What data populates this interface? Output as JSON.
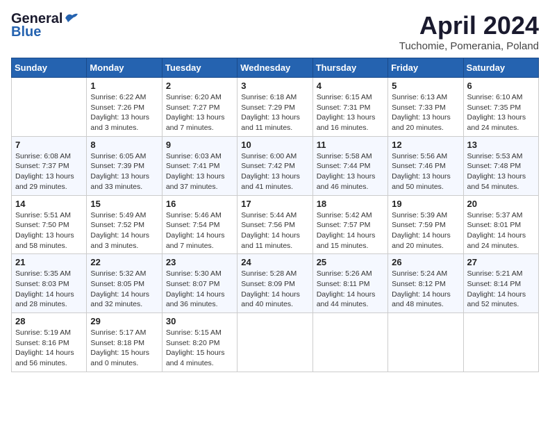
{
  "header": {
    "logo_general": "General",
    "logo_blue": "Blue",
    "month_title": "April 2024",
    "location": "Tuchomie, Pomerania, Poland"
  },
  "calendar": {
    "days_of_week": [
      "Sunday",
      "Monday",
      "Tuesday",
      "Wednesday",
      "Thursday",
      "Friday",
      "Saturday"
    ],
    "weeks": [
      [
        {
          "day": "",
          "info": ""
        },
        {
          "day": "1",
          "info": "Sunrise: 6:22 AM\nSunset: 7:26 PM\nDaylight: 13 hours\nand 3 minutes."
        },
        {
          "day": "2",
          "info": "Sunrise: 6:20 AM\nSunset: 7:27 PM\nDaylight: 13 hours\nand 7 minutes."
        },
        {
          "day": "3",
          "info": "Sunrise: 6:18 AM\nSunset: 7:29 PM\nDaylight: 13 hours\nand 11 minutes."
        },
        {
          "day": "4",
          "info": "Sunrise: 6:15 AM\nSunset: 7:31 PM\nDaylight: 13 hours\nand 16 minutes."
        },
        {
          "day": "5",
          "info": "Sunrise: 6:13 AM\nSunset: 7:33 PM\nDaylight: 13 hours\nand 20 minutes."
        },
        {
          "day": "6",
          "info": "Sunrise: 6:10 AM\nSunset: 7:35 PM\nDaylight: 13 hours\nand 24 minutes."
        }
      ],
      [
        {
          "day": "7",
          "info": "Sunrise: 6:08 AM\nSunset: 7:37 PM\nDaylight: 13 hours\nand 29 minutes."
        },
        {
          "day": "8",
          "info": "Sunrise: 6:05 AM\nSunset: 7:39 PM\nDaylight: 13 hours\nand 33 minutes."
        },
        {
          "day": "9",
          "info": "Sunrise: 6:03 AM\nSunset: 7:41 PM\nDaylight: 13 hours\nand 37 minutes."
        },
        {
          "day": "10",
          "info": "Sunrise: 6:00 AM\nSunset: 7:42 PM\nDaylight: 13 hours\nand 41 minutes."
        },
        {
          "day": "11",
          "info": "Sunrise: 5:58 AM\nSunset: 7:44 PM\nDaylight: 13 hours\nand 46 minutes."
        },
        {
          "day": "12",
          "info": "Sunrise: 5:56 AM\nSunset: 7:46 PM\nDaylight: 13 hours\nand 50 minutes."
        },
        {
          "day": "13",
          "info": "Sunrise: 5:53 AM\nSunset: 7:48 PM\nDaylight: 13 hours\nand 54 minutes."
        }
      ],
      [
        {
          "day": "14",
          "info": "Sunrise: 5:51 AM\nSunset: 7:50 PM\nDaylight: 13 hours\nand 58 minutes."
        },
        {
          "day": "15",
          "info": "Sunrise: 5:49 AM\nSunset: 7:52 PM\nDaylight: 14 hours\nand 3 minutes."
        },
        {
          "day": "16",
          "info": "Sunrise: 5:46 AM\nSunset: 7:54 PM\nDaylight: 14 hours\nand 7 minutes."
        },
        {
          "day": "17",
          "info": "Sunrise: 5:44 AM\nSunset: 7:56 PM\nDaylight: 14 hours\nand 11 minutes."
        },
        {
          "day": "18",
          "info": "Sunrise: 5:42 AM\nSunset: 7:57 PM\nDaylight: 14 hours\nand 15 minutes."
        },
        {
          "day": "19",
          "info": "Sunrise: 5:39 AM\nSunset: 7:59 PM\nDaylight: 14 hours\nand 20 minutes."
        },
        {
          "day": "20",
          "info": "Sunrise: 5:37 AM\nSunset: 8:01 PM\nDaylight: 14 hours\nand 24 minutes."
        }
      ],
      [
        {
          "day": "21",
          "info": "Sunrise: 5:35 AM\nSunset: 8:03 PM\nDaylight: 14 hours\nand 28 minutes."
        },
        {
          "day": "22",
          "info": "Sunrise: 5:32 AM\nSunset: 8:05 PM\nDaylight: 14 hours\nand 32 minutes."
        },
        {
          "day": "23",
          "info": "Sunrise: 5:30 AM\nSunset: 8:07 PM\nDaylight: 14 hours\nand 36 minutes."
        },
        {
          "day": "24",
          "info": "Sunrise: 5:28 AM\nSunset: 8:09 PM\nDaylight: 14 hours\nand 40 minutes."
        },
        {
          "day": "25",
          "info": "Sunrise: 5:26 AM\nSunset: 8:11 PM\nDaylight: 14 hours\nand 44 minutes."
        },
        {
          "day": "26",
          "info": "Sunrise: 5:24 AM\nSunset: 8:12 PM\nDaylight: 14 hours\nand 48 minutes."
        },
        {
          "day": "27",
          "info": "Sunrise: 5:21 AM\nSunset: 8:14 PM\nDaylight: 14 hours\nand 52 minutes."
        }
      ],
      [
        {
          "day": "28",
          "info": "Sunrise: 5:19 AM\nSunset: 8:16 PM\nDaylight: 14 hours\nand 56 minutes."
        },
        {
          "day": "29",
          "info": "Sunrise: 5:17 AM\nSunset: 8:18 PM\nDaylight: 15 hours\nand 0 minutes."
        },
        {
          "day": "30",
          "info": "Sunrise: 5:15 AM\nSunset: 8:20 PM\nDaylight: 15 hours\nand 4 minutes."
        },
        {
          "day": "",
          "info": ""
        },
        {
          "day": "",
          "info": ""
        },
        {
          "day": "",
          "info": ""
        },
        {
          "day": "",
          "info": ""
        }
      ]
    ]
  }
}
